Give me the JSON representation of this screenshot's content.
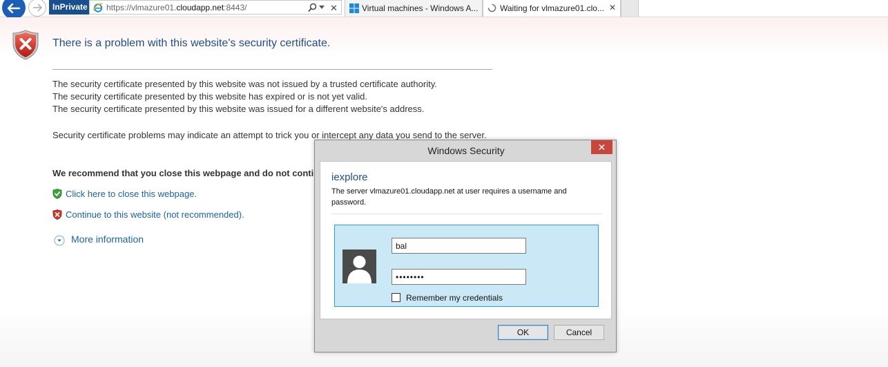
{
  "browser": {
    "inprivate_label": "InPrivate",
    "url_prefix": "https://vlmazure01.",
    "url_domain": "cloudapp.net",
    "url_suffix": ":8443/",
    "tabs": [
      {
        "label": "Virtual machines - Windows A...",
        "icon": "windows-logo-icon"
      },
      {
        "label": "Waiting for vlmazure01.clo...",
        "icon": "loading-spinner-icon",
        "close": "✕"
      }
    ],
    "stop_glyph": "✕"
  },
  "page": {
    "title": "There is a problem with this website's security certificate.",
    "reasons": [
      "The security certificate presented by this website was not issued by a trusted certificate authority.",
      "The security certificate presented by this website has expired or is not yet valid.",
      "The security certificate presented by this website was issued for a different website's address."
    ],
    "warning": "Security certificate problems may indicate an attempt to trick you or intercept any data you send to the server.",
    "recommend": "We recommend that you close this webpage and do not continue to this website.",
    "close_link": "Click here to close this webpage.",
    "continue_link": "Continue to this website (not recommended).",
    "more_info": "More information"
  },
  "dialog": {
    "title": "Windows Security",
    "close_glyph": "✕",
    "app": "iexplore",
    "message": "The server vlmazure01.cloudapp.net at user requires a username and password.",
    "username": "bal",
    "password": "password",
    "remember_label": "Remember my credentials",
    "remember_checked": false,
    "ok_label": "OK",
    "cancel_label": "Cancel"
  },
  "colors": {
    "accent": "#1c5fb8",
    "link": "#1a62a8",
    "heading": "#1e4f8c",
    "danger": "#c9463d",
    "tile": "#cbe8f6"
  }
}
